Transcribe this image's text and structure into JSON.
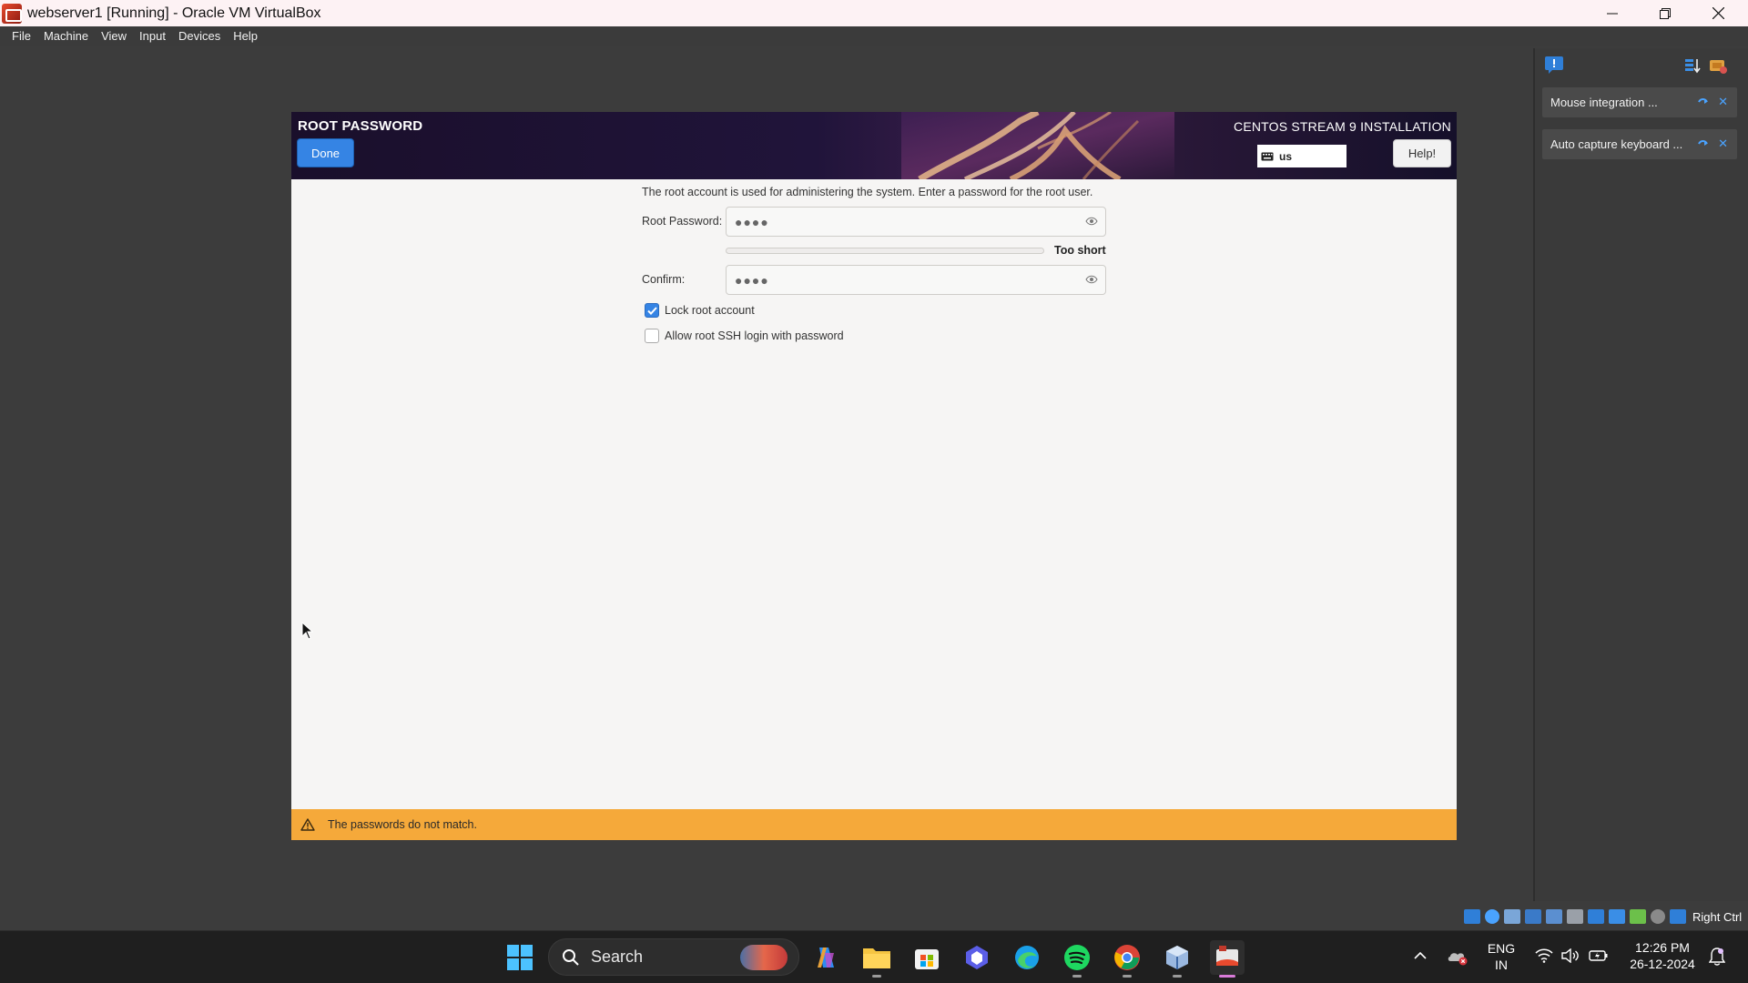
{
  "window": {
    "title": "webserver1 [Running] - Oracle VM VirtualBox",
    "menu": [
      "File",
      "Machine",
      "View",
      "Input",
      "Devices",
      "Help"
    ]
  },
  "installer": {
    "spoke_title": "ROOT PASSWORD",
    "done_label": "Done",
    "product_title": "CENTOS STREAM 9 INSTALLATION",
    "keyboard_layout": "us",
    "help_label": "Help!",
    "description": "The root account is used for administering the system.  Enter a password for the root user.",
    "root_password_label": "Root Password:",
    "root_password_value": "●●●●",
    "strength_text": "Too short",
    "strength_fraction": 0,
    "confirm_label": "Confirm:",
    "confirm_value": "●●●●",
    "lock_root_label": "Lock root account",
    "lock_root_checked": true,
    "ssh_login_label": "Allow root SSH login with password",
    "ssh_login_checked": false,
    "warning_text": "The passwords do not match."
  },
  "notifications": [
    {
      "text": "Mouse integration ..."
    },
    {
      "text": "Auto capture keyboard ..."
    }
  ],
  "statusbar": {
    "host_key": "Right Ctrl"
  },
  "taskbar": {
    "search_placeholder": "Search",
    "language": "ENG",
    "region": "IN",
    "time": "12:26 PM",
    "date": "26-12-2024"
  },
  "colors": {
    "accent_blue": "#3584e4",
    "warning_orange": "#f5a93a",
    "taskbar_bg": "#1f1f1f",
    "host_bg": "#3c3c3c"
  }
}
